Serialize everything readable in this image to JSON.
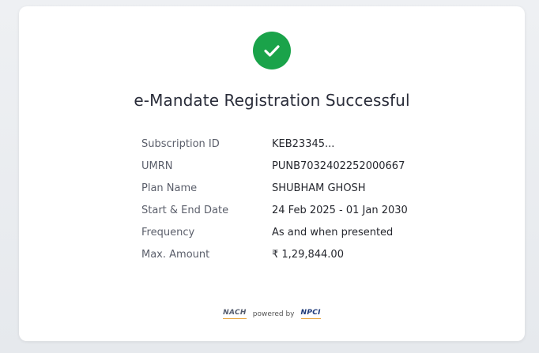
{
  "colors": {
    "success": "#1aa34a",
    "title": "#2a2d3a",
    "label": "#5b5f6b"
  },
  "status_icon": "check-icon",
  "title": "e-Mandate Registration Successful",
  "details": [
    {
      "label": "Subscription ID",
      "value": "KEB23345..."
    },
    {
      "label": "UMRN",
      "value": "PUNB7032402252000667"
    },
    {
      "label": "Plan Name",
      "value": "SHUBHAM GHOSH"
    },
    {
      "label": "Start & End Date",
      "value": "24 Feb 2025 - 01 Jan 2030"
    },
    {
      "label": "Frequency",
      "value": "As and when presented"
    },
    {
      "label": "Max. Amount",
      "value": "₹ 1,29,844.00"
    }
  ],
  "footer": {
    "nach_logo": "NACH",
    "powered_by": "powered by",
    "npci_logo": "NPCI"
  }
}
